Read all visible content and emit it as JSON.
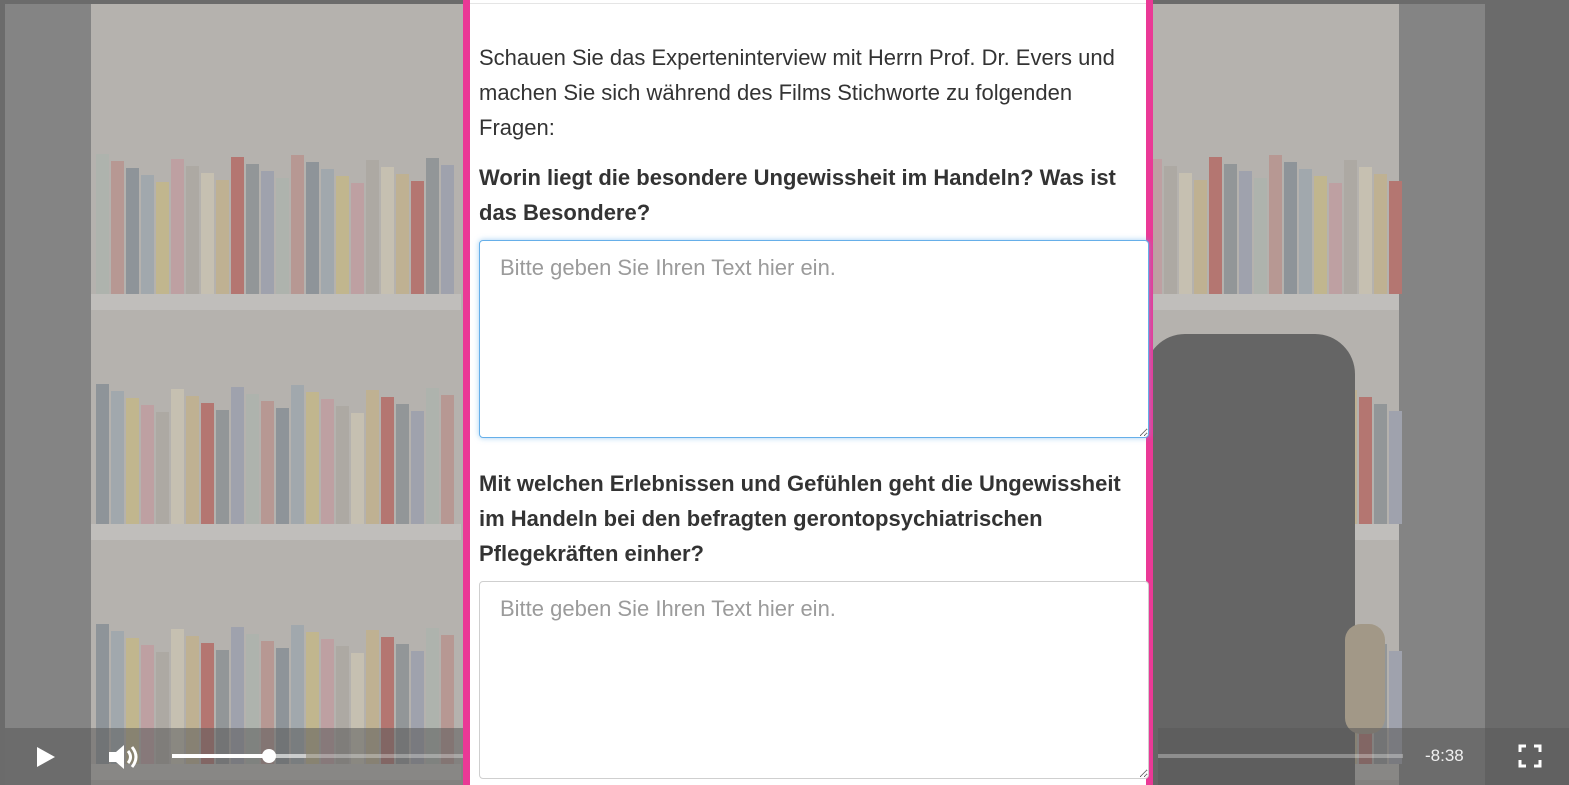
{
  "modal": {
    "intro": "Schauen Sie das Experteninterview mit Herrn Prof. Dr. Evers und machen Sie sich während des Films Stichworte zu folgenden Fragen:",
    "question1": "Worin liegt die besondere Ungewissheit im Handeln? Was ist das Besondere?",
    "answer1_placeholder": "Bitte geben Sie Ihren Text hier ein.",
    "question2": "Mit welchen Erlebnissen und Gefühlen geht die Ungewissheit im Handeln bei den befragten gerontopsychiatrischen Pflegekräften einher?",
    "answer2_placeholder": "Bitte geben Sie Ihren Text hier ein."
  },
  "player": {
    "time_remaining": "-8:38",
    "progress_fraction": 0.079,
    "buffered_fraction": 0.109,
    "icons": {
      "play": "play-icon",
      "volume": "volume-icon",
      "fullscreen": "fullscreen-icon"
    }
  },
  "colors": {
    "modal_border": "#ea3996",
    "focus_outline": "#66afe9"
  }
}
